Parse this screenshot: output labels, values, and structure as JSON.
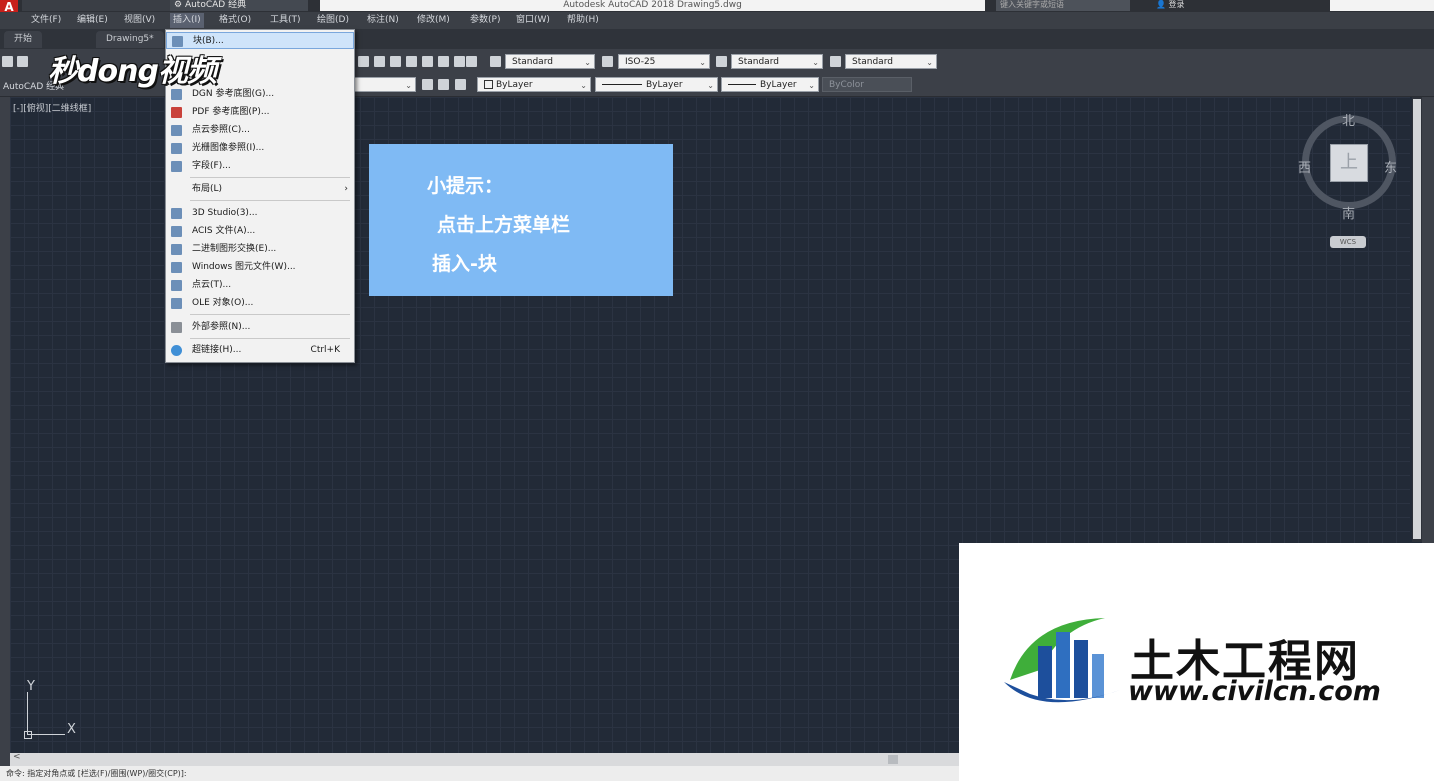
{
  "titlebar": {
    "app_icon": "A",
    "workspace": "AutoCAD 经典",
    "window_title": "Autodesk AutoCAD 2018    Drawing5.dwg",
    "search_placeholder": "键入关键字或短语",
    "login": "登录"
  },
  "menubar": [
    "文件(F)",
    "编辑(E)",
    "视图(V)",
    "插入(I)",
    "格式(O)",
    "工具(T)",
    "绘图(D)",
    "标注(N)",
    "修改(M)",
    "参数(P)",
    "窗口(W)",
    "帮助(H)"
  ],
  "tabs": [
    "开始",
    "Drawing5*"
  ],
  "toolbar1": {
    "text_style": "Standard",
    "dim_style": "ISO-25",
    "table_style": "Standard",
    "mleader_style": "Standard"
  },
  "toolbar2": {
    "workspace_label": "AutoCAD 经典",
    "color": "ByLayer",
    "linetype": "ByLayer",
    "lineweight": "ByLayer",
    "plotstyle": "ByColor"
  },
  "viewport_label": "[-][俯视][二维线框]",
  "insert_menu": {
    "block": "块(B)...",
    "dgn": "DGN 参考底图(G)...",
    "pdf": "PDF 参考底图(P)...",
    "pointcloud_ref": "点云参照(C)...",
    "raster": "光栅图像参照(I)...",
    "field": "字段(F)...",
    "layout": "布局(L)",
    "studio": "3D Studio(3)...",
    "acis": "ACIS 文件(A)...",
    "dxb": "二进制图形交换(E)...",
    "wmf": "Windows 图元文件(W)...",
    "pointcloud": "点云(T)...",
    "ole": "OLE 对象(O)...",
    "xref": "外部参照(N)...",
    "hyperlink": "超链接(H)...",
    "hyperlink_shortcut": "Ctrl+K"
  },
  "watermark": "秒dong视频",
  "hint": {
    "line1": "小提示：",
    "line2": "点击上方菜单栏",
    "line3": "插入-块"
  },
  "viewcube": {
    "north": "北",
    "south": "南",
    "east": "东",
    "west": "西",
    "face": "上",
    "wcs": "WCS"
  },
  "ucs": {
    "x": "X",
    "y": "Y"
  },
  "command_line": "命令: 指定对角点或 [栏选(F)/圈围(WP)/圈交(CP)]:",
  "logo": {
    "name": "土木工程网",
    "url": "www.civilcn.com"
  },
  "colors": {
    "canvas": "#222a37",
    "hint_box": "#7fbaf4",
    "menu_highlight": "#cfe4fa"
  }
}
